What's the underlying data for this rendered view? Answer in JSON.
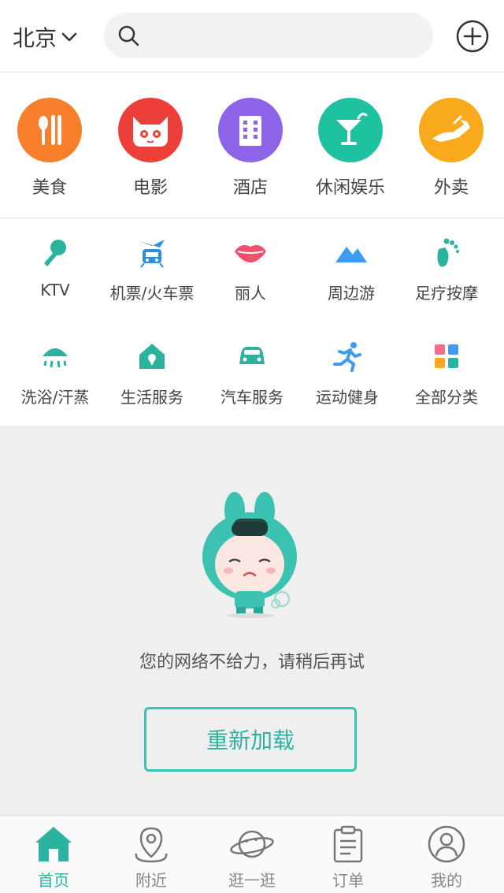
{
  "header": {
    "city": "北京",
    "search_placeholder": ""
  },
  "big_categories": [
    {
      "label": "美食",
      "icon": "fork-knife-icon",
      "color": "#f77f2a"
    },
    {
      "label": "电影",
      "icon": "cat-face-icon",
      "color": "#ec3f3a"
    },
    {
      "label": "酒店",
      "icon": "building-icon",
      "color": "#8d63e8"
    },
    {
      "label": "休闲娱乐",
      "icon": "cocktail-icon",
      "color": "#1ec2a0"
    },
    {
      "label": "外卖",
      "icon": "kangaroo-icon",
      "color": "#f9a91c"
    }
  ],
  "small_categories": [
    {
      "label": "KTV",
      "icon": "microphone-icon"
    },
    {
      "label": "机票/火车票",
      "icon": "plane-train-icon"
    },
    {
      "label": "丽人",
      "icon": "lips-icon"
    },
    {
      "label": "周边游",
      "icon": "mountain-icon"
    },
    {
      "label": "足疗按摩",
      "icon": "foot-icon"
    },
    {
      "label": "洗浴/汗蒸",
      "icon": "shower-icon"
    },
    {
      "label": "生活服务",
      "icon": "house-pin-icon"
    },
    {
      "label": "汽车服务",
      "icon": "car-icon"
    },
    {
      "label": "运动健身",
      "icon": "running-icon"
    },
    {
      "label": "全部分类",
      "icon": "grid-icon"
    }
  ],
  "error": {
    "message": "您的网络不给力，请稍后再试",
    "reload_label": "重新加载"
  },
  "tabs": [
    {
      "label": "首页",
      "icon": "home-icon",
      "active": true
    },
    {
      "label": "附近",
      "icon": "location-pin-icon",
      "active": false
    },
    {
      "label": "逛一逛",
      "icon": "planet-icon",
      "active": false
    },
    {
      "label": "订单",
      "icon": "clipboard-icon",
      "active": false
    },
    {
      "label": "我的",
      "icon": "user-icon",
      "active": false
    }
  ],
  "colors": {
    "accent": "#2bb3a0",
    "background_gray": "#efefef"
  }
}
